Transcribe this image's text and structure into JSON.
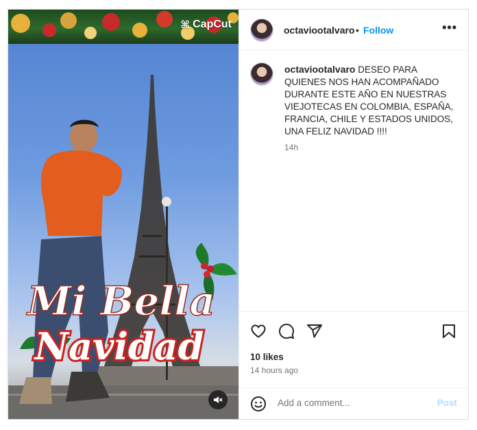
{
  "media": {
    "watermark": "CapCut",
    "title_line1": "Mi Bella",
    "title_line2": "Navidad",
    "mute_icon": "speaker-muted-icon"
  },
  "header": {
    "username": "octaviootalvaro",
    "separator": "•",
    "follow_label": "Follow",
    "more_label": "•••"
  },
  "caption": {
    "username": "octaviootalvaro",
    "text": "DESEO PARA QUIENES NOS HAN ACOMPAÑADO DURANTE ESTE AÑO EN NUESTRAS VIEJOTECAS EN COLOMBIA, ESPAÑA, FRANCIA, CHILE Y ESTADOS UNIDOS, UNA FELIZ NAVIDAD !!!!",
    "time": "14h"
  },
  "actions": {
    "icons": [
      "heart-icon",
      "comment-icon",
      "share-icon",
      "bookmark-icon"
    ],
    "likes": "10 likes",
    "posted": "14 hours ago"
  },
  "comment": {
    "placeholder": "Add a comment...",
    "post_label": "Post"
  },
  "colors": {
    "accent": "#0095f6",
    "post_disabled": "#b2dffc",
    "muted_text": "#737373"
  }
}
